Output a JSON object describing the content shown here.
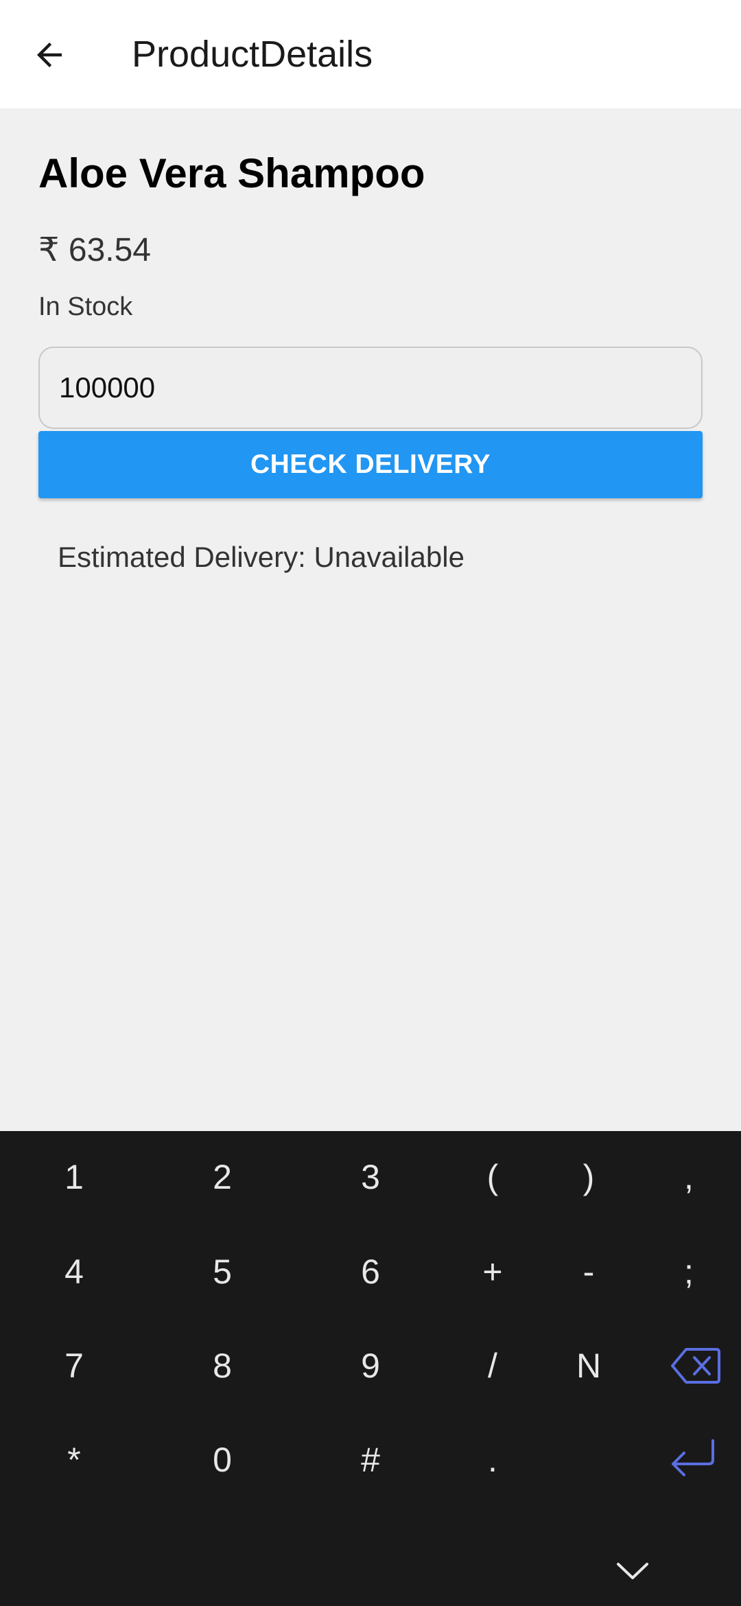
{
  "app_bar": {
    "title": "ProductDetails",
    "back_icon": "arrow-left-icon"
  },
  "product": {
    "name": "Aloe Vera Shampoo",
    "price": "₹ 63.54",
    "stock_status": "In Stock"
  },
  "pincode": {
    "value": "100000"
  },
  "check_button": {
    "label": "CHECK DELIVERY",
    "color": "#2196f3"
  },
  "delivery": {
    "estimate": "Estimated Delivery: Unavailable"
  },
  "keyboard": {
    "rows": [
      [
        "1",
        "2",
        "3",
        "(",
        ")",
        ","
      ],
      [
        "4",
        "5",
        "6",
        "+",
        "-",
        ";"
      ],
      [
        "7",
        "8",
        "9",
        "/",
        "N"
      ],
      [
        "*",
        "0",
        "#",
        "."
      ]
    ],
    "backspace_icon": "backspace-icon",
    "enter_icon": "enter-icon",
    "collapse_icon": "chevron-down-icon",
    "accent_color": "#5b6ee1"
  }
}
